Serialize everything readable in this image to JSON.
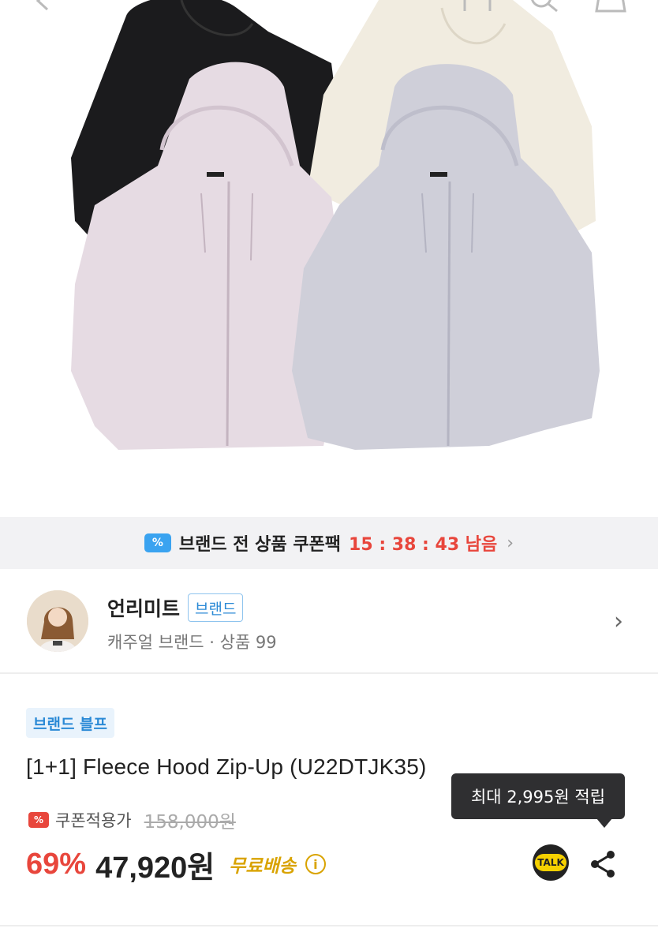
{
  "coupon_bar": {
    "icon": "coupon-ticket-icon",
    "icon_glyph": "%",
    "text": "브랜드 전 상품 쿠폰팩",
    "timer": "15 : 38 : 43 남음",
    "chevron": "›"
  },
  "brand": {
    "name": "언리미트",
    "badge": "브랜드",
    "sub": "캐주얼 브랜드 · 상품 99",
    "chevron": "›"
  },
  "product": {
    "tag": "브랜드 블프",
    "title": "[1+1] Fleece Hood Zip-Up (U22DTJK35)",
    "coupon_icon_glyph": "%",
    "coupon_price_label": "쿠폰적용가",
    "original_price": "158,000원",
    "discount": "69%",
    "final_price": "47,920원",
    "free_shipping": "무료배송",
    "info_glyph": "i"
  },
  "tooltip": {
    "text": "최대 2,995원 적립"
  },
  "actions": {
    "talk_label": "TALK"
  },
  "colors": {
    "accent_red": "#e8463c",
    "accent_blue": "#2b8ad6",
    "shipping_gold": "#d9a300",
    "hoodie_black": "#1b1b1d",
    "hoodie_cream": "#f1ece0",
    "hoodie_pink": "#e6dbe3",
    "hoodie_grey": "#cfcfd9"
  }
}
